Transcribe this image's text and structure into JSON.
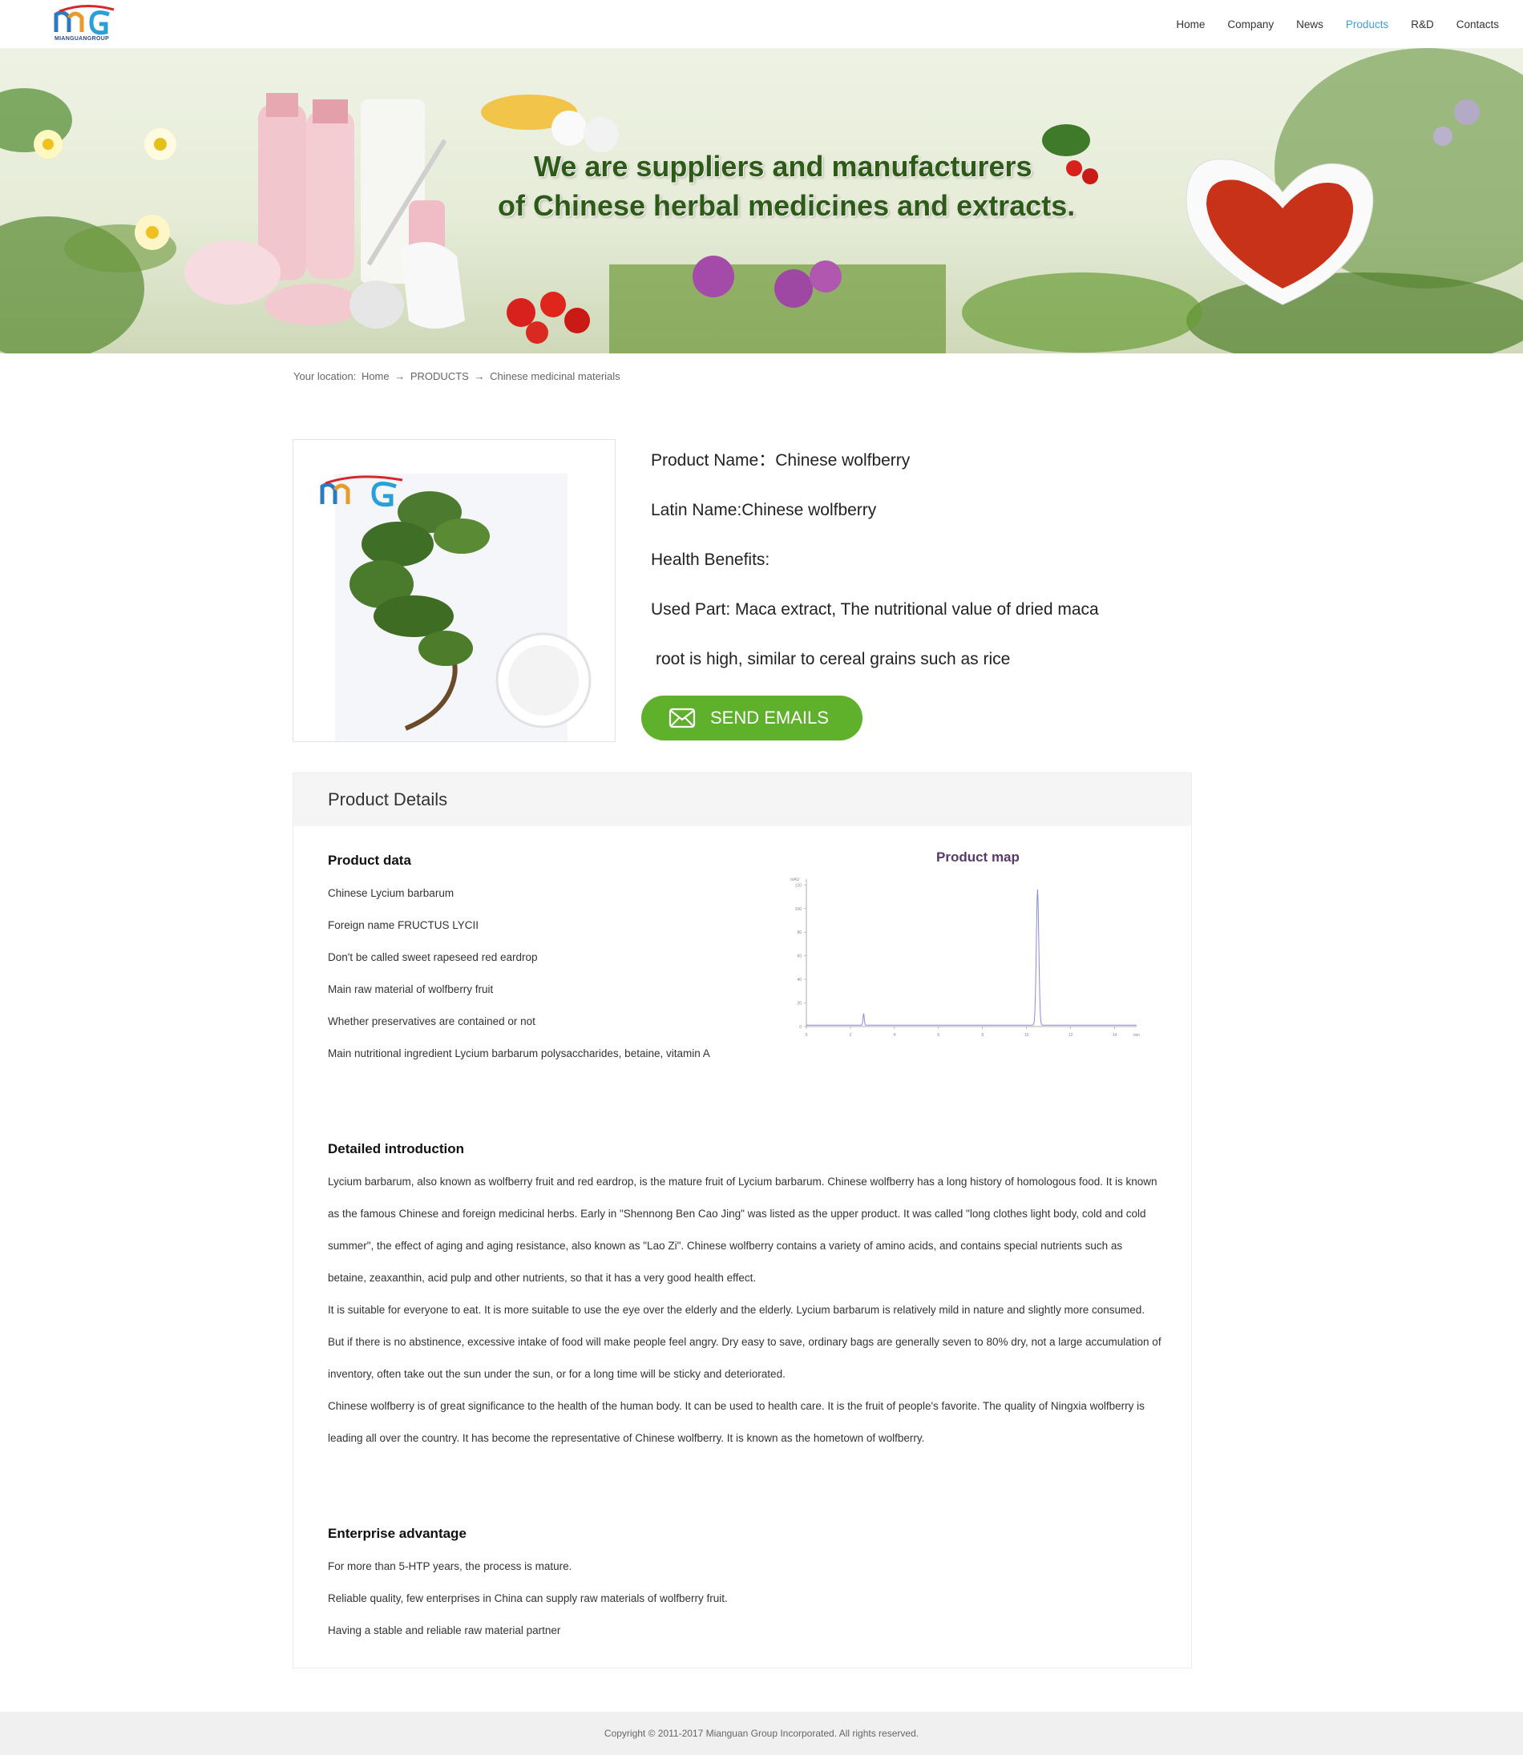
{
  "header": {
    "logo_text": "MIANGUANGROUP",
    "nav": [
      {
        "label": "Home",
        "active": false
      },
      {
        "label": "Company",
        "active": false
      },
      {
        "label": "News",
        "active": false
      },
      {
        "label": "Products",
        "active": true
      },
      {
        "label": "R&D",
        "active": false
      },
      {
        "label": "Contacts",
        "active": false
      }
    ]
  },
  "banner": {
    "line1": "We are suppliers and manufacturers",
    "line2": "of Chinese herbal medicines and extracts."
  },
  "breadcrumb": {
    "prefix": "Your location:",
    "items": [
      "Home",
      "PRODUCTS",
      "Chinese medicinal materials"
    ],
    "separator": "→"
  },
  "product": {
    "name_line": "Product Name：Chinese wolfberry",
    "latin_line": "Latin Name:Chinese wolfberry",
    "benefits_line": "Health Benefits:",
    "used_part_line1": "Used Part: Maca  extract,    The nutritional value of dried maca",
    "used_part_line2": "root is high, similar to cereal grains such as rice",
    "send_button": "SEND EMAILS"
  },
  "details": {
    "heading": "Product Details",
    "product_data_title": "Product data",
    "product_data_items": [
      "Chinese Lycium barbarum",
      "Foreign name FRUCTUS LYCII",
      "Don't be called sweet rapeseed red eardrop",
      "Main raw material of wolfberry fruit",
      "Whether preservatives are contained or not",
      "Main nutritional ingredient Lycium barbarum polysaccharides, betaine, vitamin A"
    ],
    "product_map_title": "Product map",
    "detailed_title": "Detailed introduction",
    "detailed_para1": "Lycium barbarum, also known as wolfberry fruit and red eardrop, is the mature fruit of Lycium barbarum. Chinese wolfberry has a long history of homologous food. It is known as the famous Chinese and foreign medicinal herbs. Early in \"Shennong Ben Cao Jing\" was listed as the upper product. It was called \"long clothes light body, cold and cold summer\", the effect of aging and aging resistance, also known as \"Lao Zi\". Chinese wolfberry contains a variety of amino acids, and contains special nutrients such as betaine, zeaxanthin, acid pulp and other nutrients, so that it has a very good health effect.",
    "detailed_para2": "It is suitable for everyone to eat. It is more suitable to use the eye over the elderly and the elderly. Lycium barbarum is relatively mild in nature and slightly more consumed. But if there is no abstinence, excessive intake of food will make people feel angry. Dry easy to save, ordinary bags are generally seven to 80% dry, not a large accumulation of inventory, often take out the sun under the sun, or for a long time will be sticky and deteriorated.",
    "detailed_para3": "Chinese wolfberry is of great significance to the health of the human body. It can be used to health care. It is the fruit of people's favorite. The quality of Ningxia wolfberry is leading all over the country. It has become the representative of Chinese wolfberry. It is known as the hometown of wolfberry.",
    "enterprise_title": "Enterprise advantage",
    "enterprise_items": [
      "For more than 5-HTP years, the process is mature.",
      "Reliable quality, few enterprises in China can supply raw materials of wolfberry fruit.",
      "Having a stable and reliable raw material partner"
    ]
  },
  "chromatogram": {
    "y_unit": "mAU",
    "x_unit": "min",
    "y_ticks": [
      "0",
      "20",
      "40",
      "60",
      "80",
      "100",
      "120"
    ],
    "x_ticks": [
      "0",
      "2",
      "4",
      "6",
      "8",
      "10",
      "12",
      "14"
    ],
    "peak_time": 10.5,
    "peak_height": 115,
    "minor_peak_time": 2.6,
    "minor_peak_height": 10,
    "line_color": "#8a8ad8"
  },
  "footer": {
    "copyright": "Copyright © 2011-2017 Mianguan Group Incorporated. All rights reserved."
  }
}
